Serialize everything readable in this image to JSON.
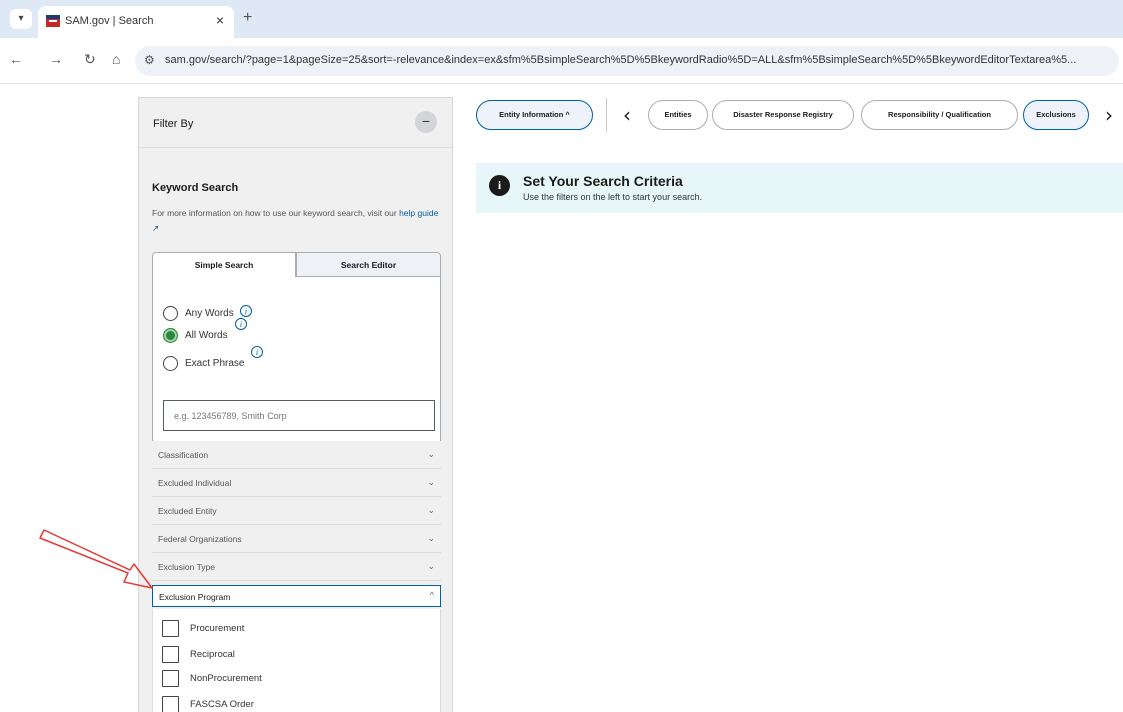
{
  "browser": {
    "tab_menu_icon": "chevron-down-icon",
    "tab_title": "SAM.gov | Search",
    "tab_close": "×",
    "new_tab": "+",
    "url": "sam.gov/search/?page=1&pageSize=25&sort=-relevance&index=ex&sfm%5BsimpleSearch%5D%5BkeywordRadio%5D=ALL&sfm%5BsimpleSearch%5D%5BkeywordEditorTextarea%5..."
  },
  "sidebar": {
    "title": "Filter By",
    "collapse_symbol": "−",
    "keyword": {
      "title": "Keyword Search",
      "desc": "For more information on how to use our keyword search, visit our ",
      "help_link": "help guide",
      "help_icon": "external-link-icon",
      "tabs": {
        "simple": "Simple Search",
        "editor": "Search Editor"
      },
      "options": [
        {
          "label": "Any Words",
          "checked": false
        },
        {
          "label": "All Words",
          "checked": true
        },
        {
          "label": "Exact Phrase",
          "checked": false
        }
      ],
      "placeholder": "e.g. 123456789, Smith Corp"
    },
    "accordions": [
      {
        "label": "Classification",
        "open": false
      },
      {
        "label": "Excluded Individual",
        "open": false
      },
      {
        "label": "Excluded Entity",
        "open": false
      },
      {
        "label": "Federal Organizations",
        "open": false
      },
      {
        "label": "Exclusion Type",
        "open": false
      },
      {
        "label": "Exclusion Program",
        "open": true
      }
    ],
    "program_options": [
      "Procurement",
      "Reciprocal",
      "NonProcurement",
      "FASCSA Order"
    ]
  },
  "nav": {
    "pills": [
      "Entity Information ^",
      "Entities",
      "Disaster Response Registry",
      "Responsibility / Qualification",
      "Exclusions"
    ],
    "active": [
      "Entity Information ^",
      "Exclusions"
    ],
    "prev": "‹",
    "next": "›"
  },
  "alert": {
    "icon": "info-icon",
    "title": "Set Your Search Criteria",
    "body": "Use the filters on the left to start your search."
  },
  "colors": {
    "accent": "#005ea2",
    "selected_radio": "#2e8540",
    "alert_bg": "#e7f6f8",
    "annotation": "#e53935"
  }
}
